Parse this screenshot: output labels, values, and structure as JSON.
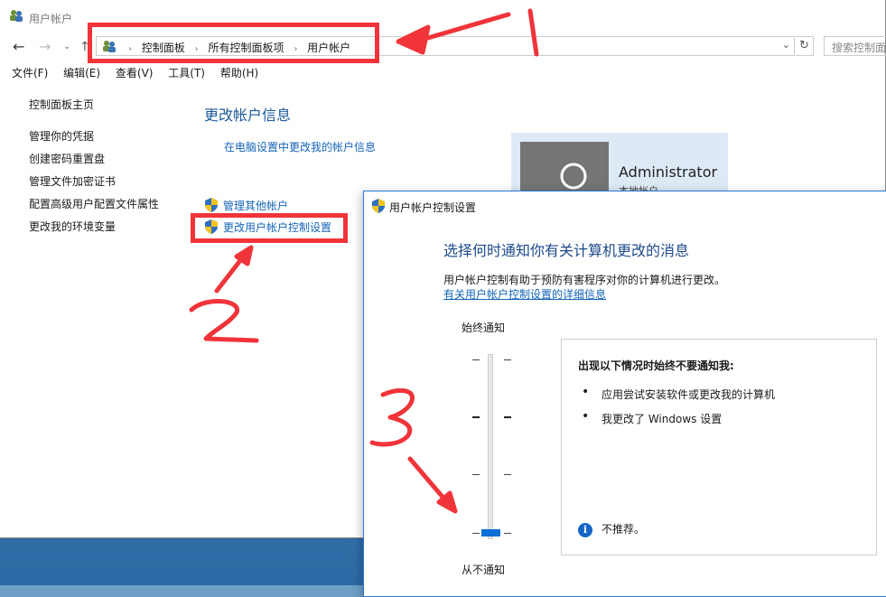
{
  "window": {
    "title": "用户帐户"
  },
  "address": {
    "crumbs": [
      "控制面板",
      "所有控制面板项",
      "用户帐户"
    ],
    "search_placeholder": "搜索控制面板"
  },
  "menu": [
    "文件(F)",
    "编辑(E)",
    "查看(V)",
    "工具(T)",
    "帮助(H)"
  ],
  "sidebar": {
    "home": "控制面板主页",
    "items": [
      "管理你的凭据",
      "创建密码重置盘",
      "管理文件加密证书",
      "配置高级用户配置文件属性",
      "更改我的环境变量"
    ]
  },
  "content": {
    "title": "更改帐户信息",
    "pc_settings_link": "在电脑设置中更改我的帐户信息",
    "manage_other": "管理其他帐户",
    "change_uac": "更改用户帐户控制设置"
  },
  "account": {
    "name": "Administrator",
    "role": "本地帐户"
  },
  "uac": {
    "title": "用户帐户控制设置",
    "heading": "选择何时通知你有关计算机更改的消息",
    "desc": "用户帐户控制有助于预防有害程序对你的计算机进行更改。",
    "more_link": "有关用户帐户控制设置的详细信息",
    "top_label": "始终通知",
    "bottom_label": "从不通知",
    "slider_level": {
      "position": 4,
      "of": 4
    },
    "box_title": "出现以下情况时始终不要通知我:",
    "bullets": [
      "应用尝试安装软件或更改我的计算机",
      "我更改了 Windows 设置"
    ],
    "warning": "不推荐。"
  },
  "colors": {
    "annotation": "#f0343a",
    "link": "#1565b8",
    "accent": "#0a6fd6"
  }
}
